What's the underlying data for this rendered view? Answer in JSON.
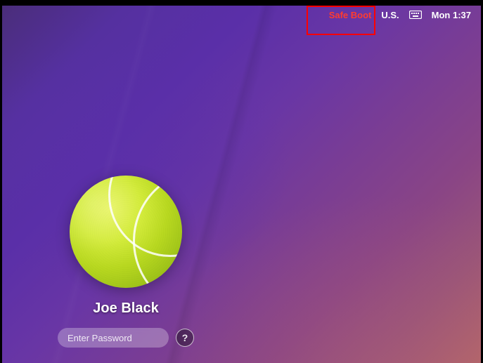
{
  "menubar": {
    "safe_boot": "Safe Boot",
    "input_source": "U.S.",
    "clock": "Mon 1:37"
  },
  "login": {
    "username": "Joe Black",
    "password_placeholder": "Enter Password",
    "avatar_description": "tennis-ball"
  },
  "hint_glyph": "?"
}
